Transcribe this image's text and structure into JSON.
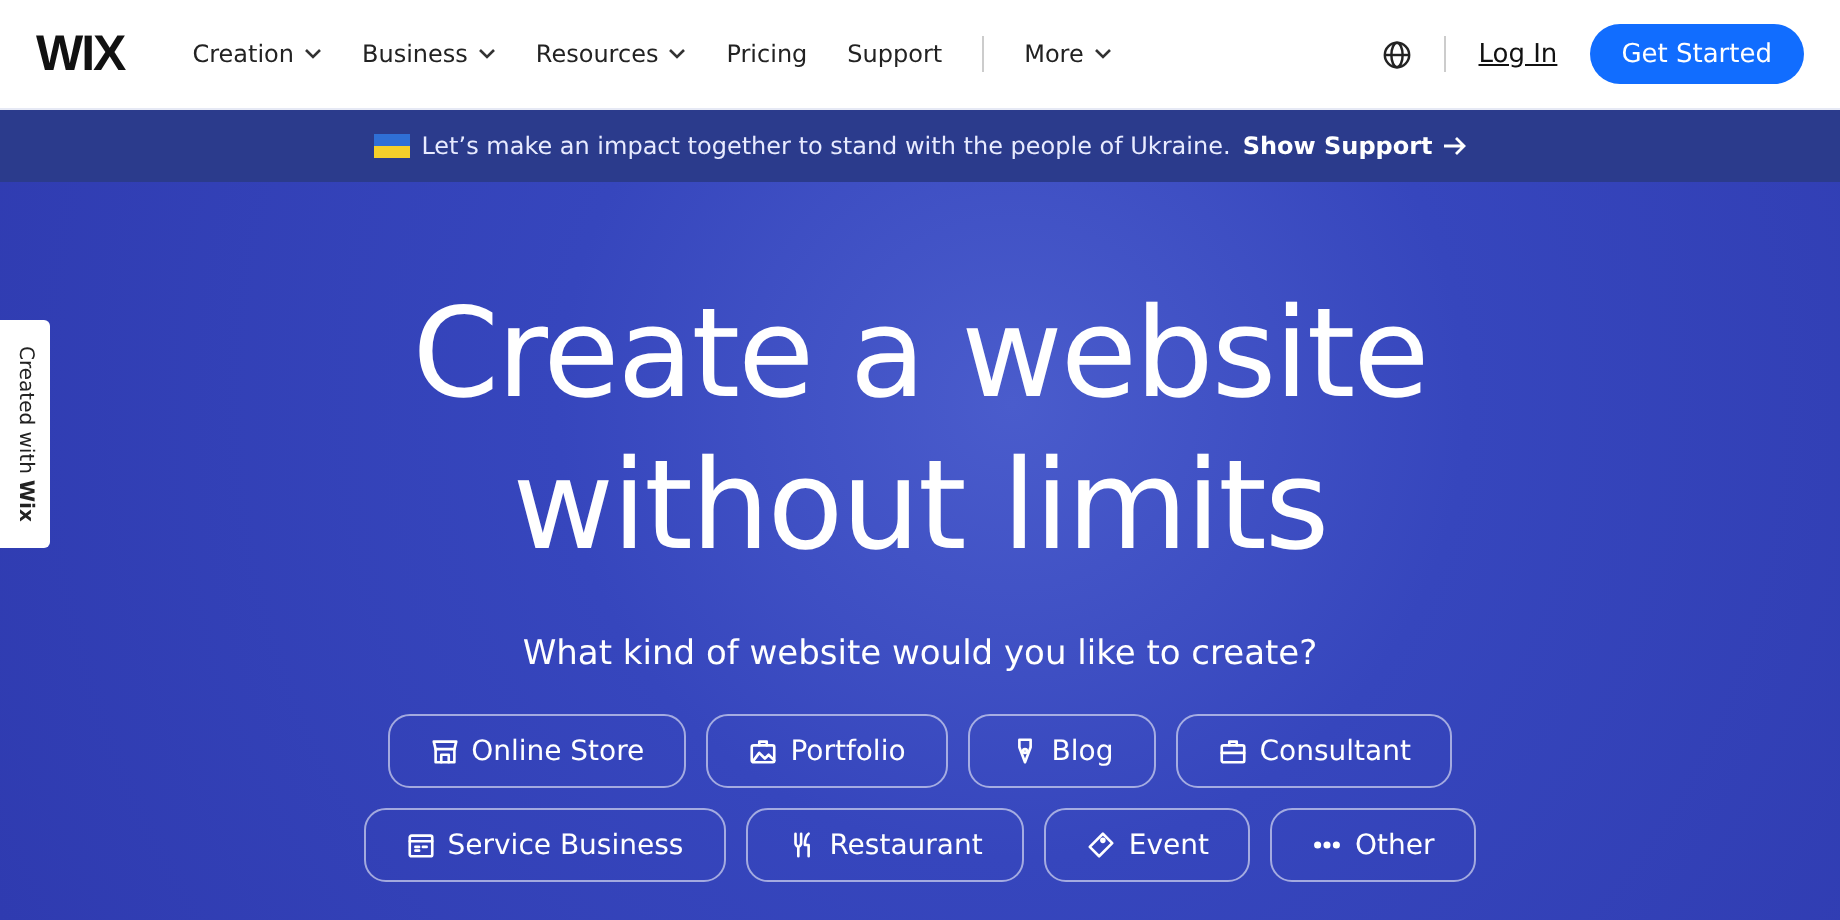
{
  "header": {
    "logo": "WIX",
    "nav": [
      {
        "label": "Creation",
        "has_menu": true
      },
      {
        "label": "Business",
        "has_menu": true
      },
      {
        "label": "Resources",
        "has_menu": true
      },
      {
        "label": "Pricing",
        "has_menu": false
      },
      {
        "label": "Support",
        "has_menu": false
      },
      {
        "label": "More",
        "has_menu": true
      }
    ],
    "login": "Log In",
    "cta": "Get Started"
  },
  "banner": {
    "text": "Let’s make an impact together to stand with the people of Ukraine.",
    "link": "Show Support"
  },
  "side_tab": "Created with **Wix**",
  "hero": {
    "title_lines": [
      "Create a website",
      "without limits"
    ],
    "subtitle": "What kind of website would you like to create?",
    "chips": [
      [
        "Online Store",
        "Portfolio",
        "Blog",
        "Consultant"
      ],
      [
        "Service Business",
        "Restaurant",
        "Event",
        "Other"
      ]
    ]
  }
}
